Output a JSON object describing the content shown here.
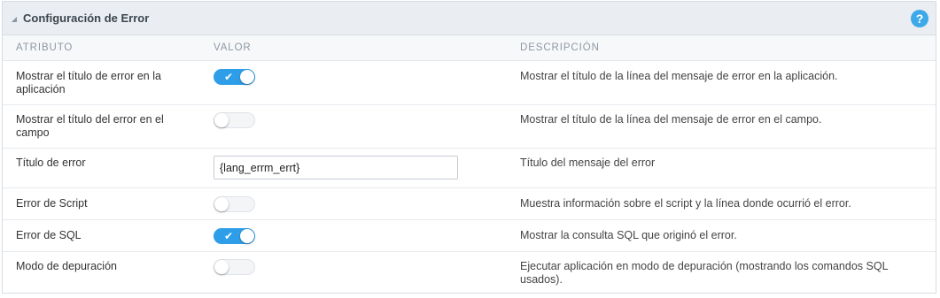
{
  "panel": {
    "title": "Configuración de Error",
    "help_label": "?"
  },
  "columns": {
    "attribute": "ATRIBUTO",
    "value": "VALOR",
    "description": "DESCRIPCIÓN"
  },
  "rows": [
    {
      "attribute": "Mostrar el título de error en la aplicación",
      "control": "toggle",
      "enabled": true,
      "description": "Mostrar el título de la línea del mensaje de error en la aplicación."
    },
    {
      "attribute": "Mostrar el título del error en el campo",
      "control": "toggle",
      "enabled": false,
      "description": "Mostrar el título de la línea del mensaje de error en el campo."
    },
    {
      "attribute": "Título de error",
      "control": "text",
      "value": "{lang_errm_errt}",
      "description": "Título del mensaje del error"
    },
    {
      "attribute": "Error de Script",
      "control": "toggle",
      "enabled": false,
      "description": "Muestra información sobre el script y la línea donde ocurrió el error."
    },
    {
      "attribute": "Error de SQL",
      "control": "toggle",
      "enabled": true,
      "description": "Mostrar la consulta SQL que originó el error."
    },
    {
      "attribute": "Modo de depuración",
      "control": "toggle",
      "enabled": false,
      "description": "Ejecutar aplicación en modo de depuración (mostrando los comandos SQL usados)."
    }
  ],
  "colors": {
    "toggle_on": "#2f9ee8",
    "help_icon": "#3ea9e8",
    "header_bg": "#eaedf1"
  },
  "icons": {
    "collapse": "triangle-collapse-icon",
    "help": "question-mark-icon",
    "toggle_on_mark": "checkmark-icon"
  }
}
